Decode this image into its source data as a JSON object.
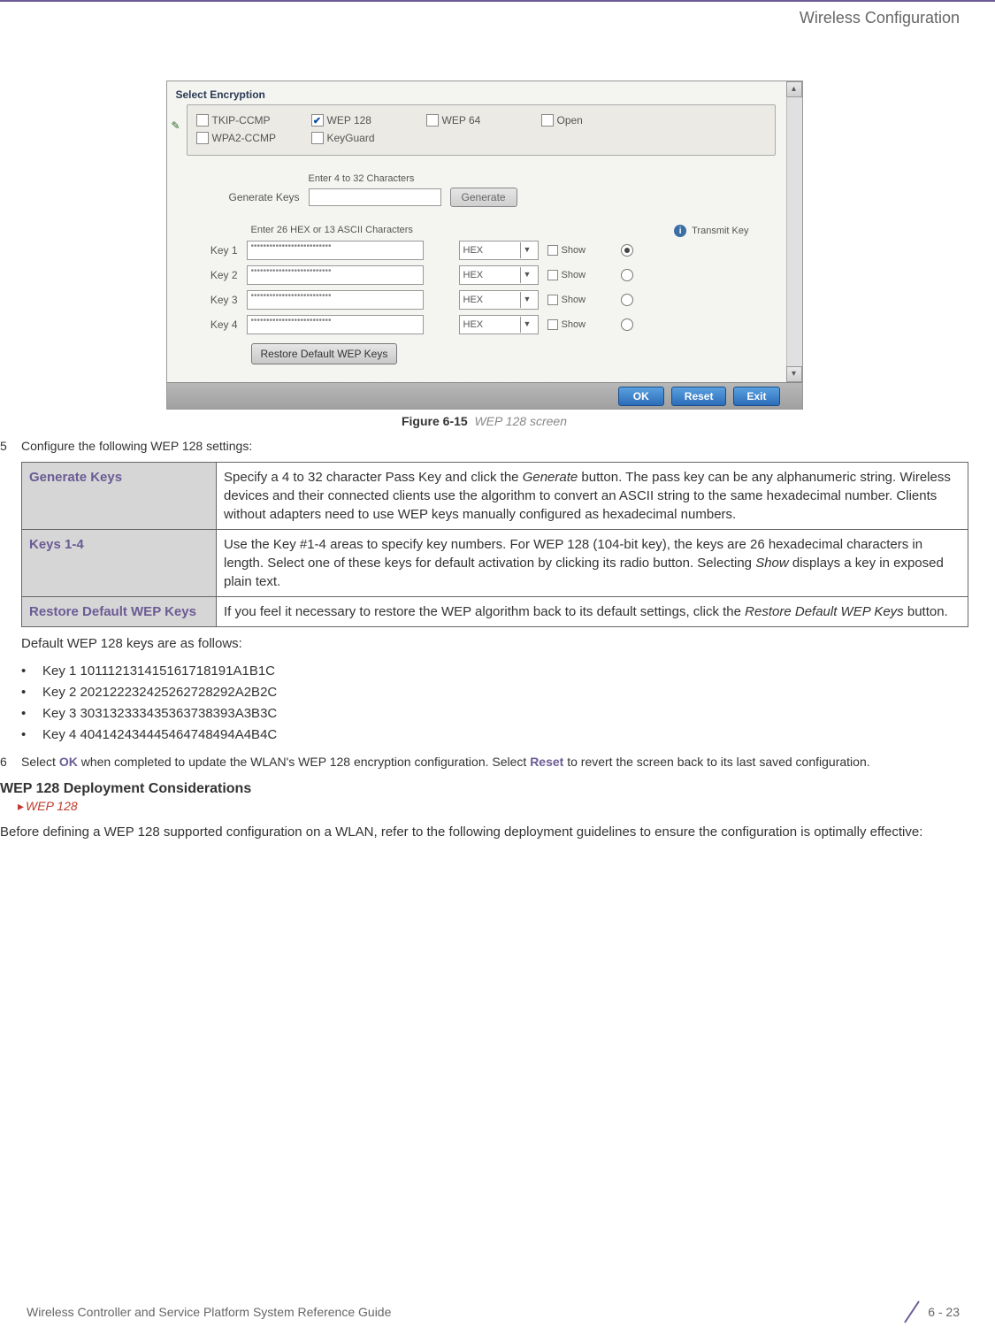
{
  "header": {
    "title": "Wireless Configuration"
  },
  "screenshot": {
    "fieldset_title": "Select Encryption",
    "options": {
      "tkip": "TKIP-CCMP",
      "wpa2": "WPA2-CCMP",
      "wep128": "WEP 128",
      "keyguard": "KeyGuard",
      "wep64": "WEP 64",
      "open": "Open"
    },
    "gen_hint": "Enter 4 to 32 Characters",
    "gen_label": "Generate Keys",
    "gen_button": "Generate",
    "keys_hint": "Enter 26 HEX or 13 ASCII Characters",
    "transmit_label": "Transmit Key",
    "keys": [
      {
        "label": "Key 1",
        "mask": "••••••••••••••••••••••••••",
        "type": "HEX",
        "show": "Show",
        "selected": true
      },
      {
        "label": "Key 2",
        "mask": "••••••••••••••••••••••••••",
        "type": "HEX",
        "show": "Show",
        "selected": false
      },
      {
        "label": "Key 3",
        "mask": "••••••••••••••••••••••••••",
        "type": "HEX",
        "show": "Show",
        "selected": false
      },
      {
        "label": "Key 4",
        "mask": "••••••••••••••••••••••••••",
        "type": "HEX",
        "show": "Show",
        "selected": false
      }
    ],
    "restore_btn": "Restore Default WEP Keys",
    "ok_btn": "OK",
    "reset_btn": "Reset",
    "exit_btn": "Exit"
  },
  "figure": {
    "label": "Figure 6-15",
    "caption": "WEP 128 screen"
  },
  "step5": {
    "num": "5",
    "text": "Configure the following WEP 128 settings:"
  },
  "table": {
    "r1": {
      "label": "Generate Keys",
      "desc_a": "Specify a 4 to 32 character Pass Key and click the ",
      "desc_i": "Generate",
      "desc_b": " button. The pass key can be any alphanumeric string. Wireless devices and their connected clients use the algorithm to convert an ASCII string to the same hexadecimal number. Clients without adapters need to use WEP keys manually configured as hexadecimal numbers."
    },
    "r2": {
      "label": "Keys 1-4",
      "desc_a": "Use the Key #1-4 areas to specify key numbers. For WEP 128 (104-bit key), the keys are 26 hexadecimal characters in length. Select one of these keys for default activation by clicking its radio button. Selecting ",
      "desc_i": "Show",
      "desc_b": " displays a key in exposed plain text."
    },
    "r3": {
      "label": "Restore Default WEP Keys",
      "desc_a": "If you feel it necessary to restore the WEP algorithm back to its default settings, click the ",
      "desc_i": "Restore Default WEP Keys",
      "desc_b": " button."
    }
  },
  "defaults": {
    "intro": "Default WEP 128 keys are as follows:",
    "items": [
      "Key 1 101112131415161718191A1B1C",
      "Key 2 202122232425262728292A2B2C",
      "Key 3 303132333435363738393A3B3C",
      "Key 4 404142434445464748494A4B4C"
    ]
  },
  "step6": {
    "num": "6",
    "pre": "Select ",
    "ok": "OK",
    "mid": " when completed to update the WLAN's WEP 128 encryption configuration. Select ",
    "reset": "Reset",
    "post": " to revert the screen back to its last saved configuration."
  },
  "subhead": "WEP 128 Deployment Considerations",
  "breadcrumb": "WEP 128",
  "afterpara": "Before defining a WEP 128 supported configuration on a WLAN, refer to the following deployment guidelines to ensure the configuration is optimally effective:",
  "footer": {
    "left": "Wireless Controller and Service Platform System Reference Guide",
    "right": "6 - 23"
  }
}
